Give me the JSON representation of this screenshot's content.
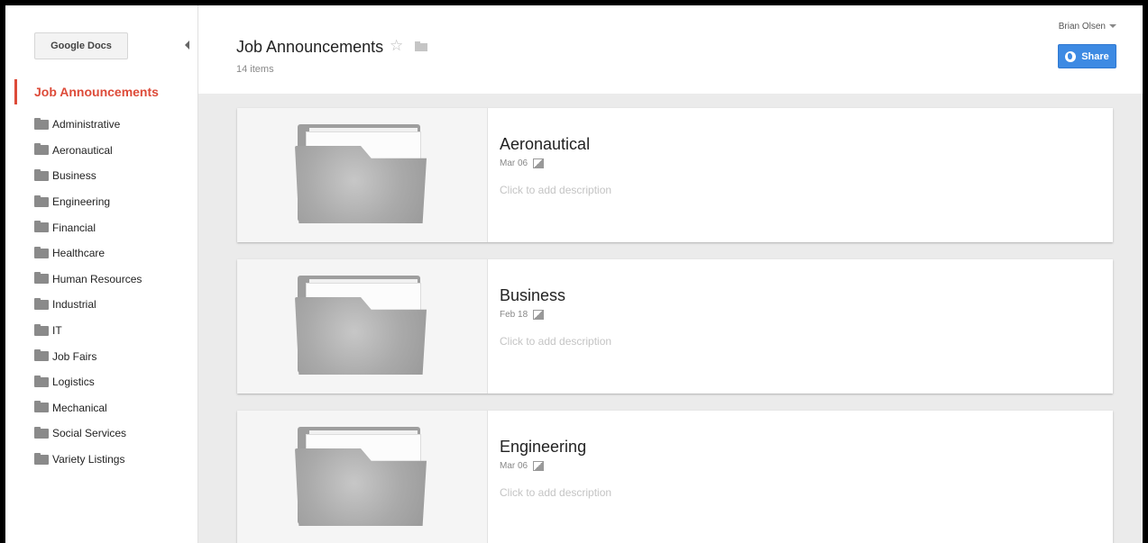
{
  "sidebar": {
    "app_button": "Google Docs",
    "current_folder": "Job Announcements",
    "folders": [
      "Administrative",
      "Aeronautical",
      "Business",
      "Engineering",
      "Financial",
      "Healthcare",
      "Human Resources",
      "Industrial",
      "IT",
      "Job Fairs",
      "Logistics",
      "Mechanical",
      "Social Services",
      "Variety Listings"
    ]
  },
  "header": {
    "title": "Job Announcements",
    "item_count": "14 items",
    "user": "Brian Olsen",
    "share_label": "Share",
    "star_icon": "star-outline-icon",
    "share_icon": "globe-icon"
  },
  "cards": [
    {
      "title": "Aeronautical",
      "date": "Mar 06",
      "description": "Click to add description"
    },
    {
      "title": "Business",
      "date": "Feb 18",
      "description": "Click to add description"
    },
    {
      "title": "Engineering",
      "date": "Mar 06",
      "description": "Click to add description"
    }
  ],
  "colors": {
    "accent_red": "#dd4b39",
    "share_blue": "#3d8ae3",
    "content_bg": "#ebebeb"
  }
}
